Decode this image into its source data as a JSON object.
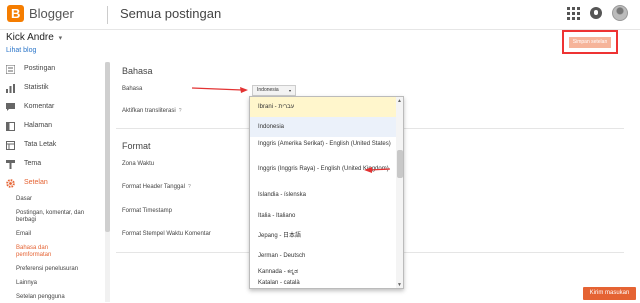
{
  "topbar": {
    "brand": "Blogger",
    "page_title": "Semua postingan",
    "icons": [
      "apps-grid-icon",
      "notifications-icon",
      "avatar-icon"
    ]
  },
  "account": {
    "name": "Kick Andre",
    "caret": "▾",
    "view_blog": "Lihat blog"
  },
  "save_button": {
    "label": "Simpan setelan"
  },
  "sidebar": {
    "items": [
      {
        "label": "Postingan",
        "icon": "posts-icon"
      },
      {
        "label": "Statistik",
        "icon": "stats-icon"
      },
      {
        "label": "Komentar",
        "icon": "comments-icon"
      },
      {
        "label": "Halaman",
        "icon": "pages-icon"
      },
      {
        "label": "Tata Letak",
        "icon": "layout-icon"
      },
      {
        "label": "Tema",
        "icon": "theme-icon"
      },
      {
        "label": "Setelan",
        "icon": "settings-icon",
        "active": true
      }
    ],
    "sub_items": [
      {
        "label": "Dasar"
      },
      {
        "label": "Postingan, komentar, dan berbagi"
      },
      {
        "label": "Email"
      },
      {
        "label": "Bahasa dan pemformatan",
        "active": true
      },
      {
        "label": "Preferensi penelusuran"
      },
      {
        "label": "Lainnya"
      },
      {
        "label": "Setelan pengguna"
      }
    ]
  },
  "main": {
    "language_section": {
      "title": "Bahasa",
      "language_label": "Bahasa",
      "transliteration_label": "Aktifkan transliterasi",
      "help": "?",
      "selected_language": "Indonesia",
      "select_caret": "▾"
    },
    "format_section": {
      "title": "Format",
      "timezone_label": "Zona Waktu",
      "date_header_label": "Format Header Tanggal",
      "timestamp_label": "Format Timestamp",
      "comment_timestamp_label": "Format Stempel Waktu Komentar",
      "help": "?"
    }
  },
  "dropdown": {
    "options": [
      "Ibrani - עברית",
      "Indonesia",
      "Inggris (Amerika Serikat) - English (United States)",
      "Inggris (Inggris Raya) - English (United Kingdom)",
      "Islandia - íslenska",
      "Italia - Italiano",
      "Jepang - 日本語",
      "Jerman - Deutsch",
      "Kannada - ಕನ್ನಡ",
      "Katalan - català"
    ],
    "scroll_up": "▲",
    "scroll_down": "▼"
  },
  "feedback": {
    "label": "Kirim masukan"
  },
  "colors": {
    "accent": "#e56333",
    "annotation_red": "#e33333",
    "link": "#2c76c9"
  }
}
